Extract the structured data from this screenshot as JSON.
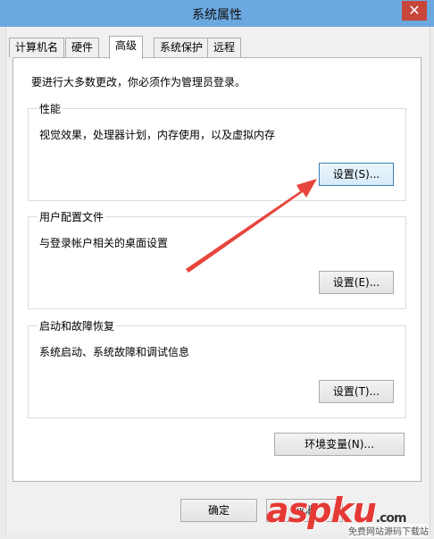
{
  "window": {
    "title": "系统属性",
    "close_glyph": "✕"
  },
  "tabs": [
    {
      "label": "计算机名",
      "active": false
    },
    {
      "label": "硬件",
      "active": false
    },
    {
      "label": "高级",
      "active": true
    },
    {
      "label": "系统保护",
      "active": false
    },
    {
      "label": "远程",
      "active": false
    }
  ],
  "notice": "要进行大多数更改，你必须作为管理员登录。",
  "performance": {
    "title": "性能",
    "desc": "视觉效果，处理器计划，内存使用，以及虚拟内存",
    "button": "设置(S)..."
  },
  "user_profiles": {
    "title": "用户配置文件",
    "desc": "与登录帐户相关的桌面设置",
    "button": "设置(E)..."
  },
  "startup_recovery": {
    "title": "启动和故障恢复",
    "desc": "系统启动、系统故障和调试信息",
    "button": "设置(T)..."
  },
  "env_button": "环境变量(N)...",
  "footer": {
    "ok": "确定",
    "cancel": "取消"
  },
  "watermark": {
    "brand": "aspku",
    "tld": ".com",
    "sub": "免费网站源码下载站"
  },
  "colors": {
    "titlebar": "#6ba8e0",
    "close": "#c7463a",
    "arrow": "#e8453c"
  }
}
